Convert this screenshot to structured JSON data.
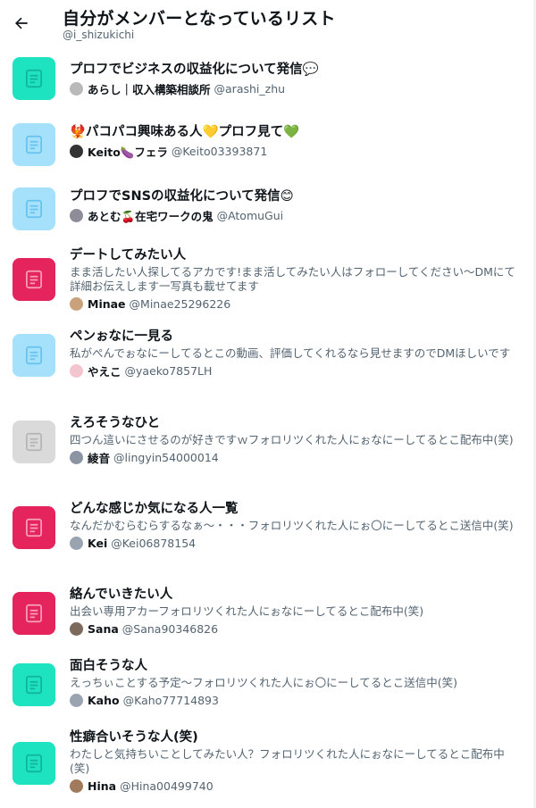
{
  "header": {
    "title": "自分がメンバーとなっているリスト",
    "handle": "@i_shizukichi",
    "back_icon": "arrow-left-icon"
  },
  "colors": {
    "teal": "#1ee3c0",
    "light_blue": "#a6e1fb",
    "crimson": "#e5245e",
    "gray": "#dadada",
    "icon_teal": "#11b399",
    "icon_light_blue": "#66c3ef",
    "icon_crimson": "#f7a0b9",
    "icon_gray": "#b5b5b5"
  },
  "lists": [
    {
      "title": "プロフでビジネスの収益化について発信💬",
      "description": "",
      "owner_name": "あらし｜収入構築相談所",
      "owner_handle": "@arashi_zhu",
      "icon_color": "teal",
      "avatar_color": "#b9b9b9"
    },
    {
      "title": "🐦‍🔥パコパコ興味ある人💛プロフ見て💚",
      "description": "",
      "owner_name": "Keito🍆フェラ",
      "owner_handle": "@Keito03393871",
      "icon_color": "light_blue",
      "avatar_color": "#333333"
    },
    {
      "title": "プロフでSNSの収益化について発信😊",
      "description": "",
      "owner_name": "あとむ🍒在宅ワークの鬼",
      "owner_handle": "@AtomuGui",
      "icon_color": "light_blue",
      "avatar_color": "#8d8d9a"
    },
    {
      "title": "デートしてみたい人",
      "description": "まま活したい人探してるアカです!まま活してみたい人はフォローしてください～DMにて詳細お伝えします一写真も載せてます",
      "owner_name": "Minae",
      "owner_handle": "@Minae25296226",
      "icon_color": "crimson",
      "avatar_color": "#c9a27c"
    },
    {
      "title": "ペンぉなに一見る",
      "description": "私がぺんでぉなにーしてるとこの動画、評価してくれるなら見せますのでDMほしいです",
      "owner_name": "やえこ",
      "owner_handle": "@yaeko7857LH",
      "icon_color": "light_blue",
      "avatar_color": "#f3c6cf"
    },
    {
      "title": "えろそうなひと",
      "description": "四つん這いにさせるのが好きですｗフォロリツくれた人にぉなにーしてるとこ配布中(笑)",
      "owner_name": "綾音",
      "owner_handle": "@lingyin54000014",
      "icon_color": "gray",
      "avatar_color": "#8a94a3"
    },
    {
      "title": "どんな感じか気になる人一覧",
      "description": "なんだかむらむらするなぁ～・・・フォロリツくれた人にぉ〇にーしてるとこ送信中(笑)",
      "owner_name": "Kei",
      "owner_handle": "@Kei06878154",
      "icon_color": "crimson",
      "avatar_color": "#9aa4b0"
    },
    {
      "title": "絡んでいきたい人",
      "description": "出会い専用アカーフォロリツくれた人にぉなにーしてるとこ配布中(笑)",
      "owner_name": "Sana",
      "owner_handle": "@Sana90346826",
      "icon_color": "crimson",
      "avatar_color": "#7c6a5d"
    },
    {
      "title": "面白そうな人",
      "description": "えっちぃことする予定～フォロリツくれた人にぉ〇にーしてるとこ送信中(笑)",
      "owner_name": "Kaho",
      "owner_handle": "@Kaho77714893",
      "icon_color": "teal",
      "avatar_color": "#9aa4b0"
    },
    {
      "title": "性癖合いそうな人(笑)",
      "description": "わたしと気持ちいことしてみたい人？フォロリツくれた人にぉなにーしてるとこ配布中(笑)",
      "owner_name": "Hina",
      "owner_handle": "@Hina00499740",
      "icon_color": "teal",
      "avatar_color": "#a07a5a"
    }
  ]
}
